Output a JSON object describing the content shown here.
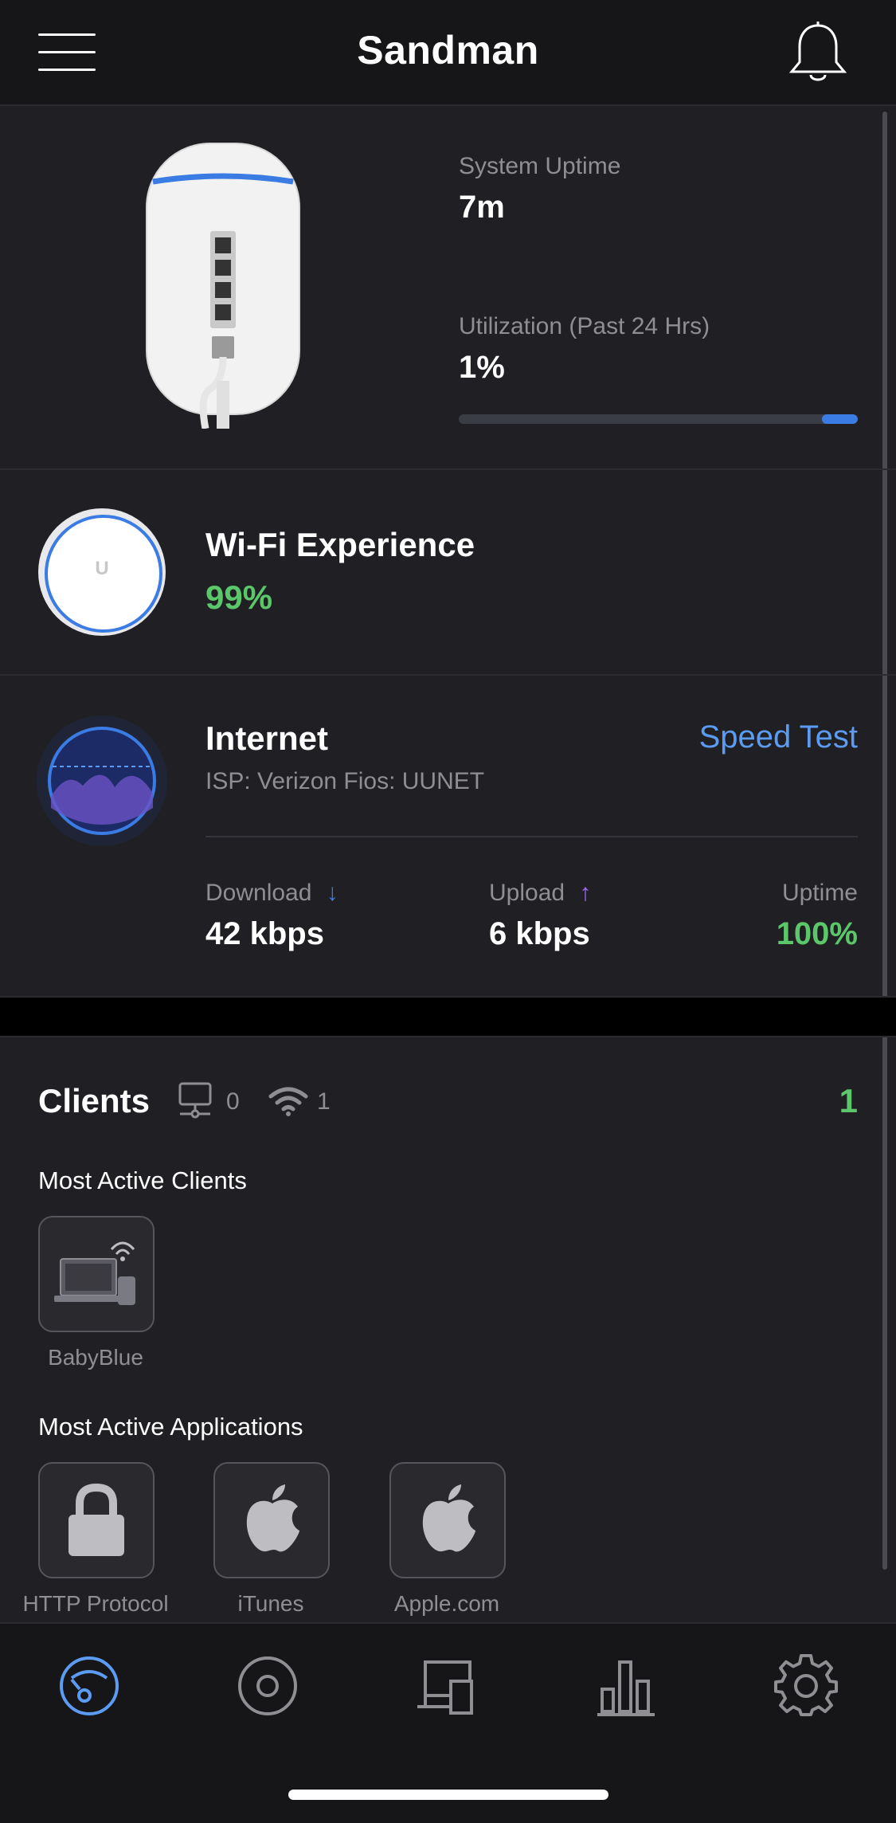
{
  "header": {
    "title": "Sandman",
    "menu_icon": "hamburger-menu-icon",
    "notifications_icon": "bell-icon"
  },
  "system": {
    "uptime_label": "System Uptime",
    "uptime_value": "7m",
    "utilization_label": "Utilization (Past 24 Hrs)",
    "utilization_value": "1%",
    "utilization_fraction": 0.09
  },
  "wifi": {
    "title": "Wi-Fi Experience",
    "value": "99%",
    "logo_letter": "U"
  },
  "internet": {
    "title": "Internet",
    "isp": "ISP: Verizon Fios: UUNET",
    "speed_test_label": "Speed Test",
    "download_label": "Download",
    "download_value": "42 kbps",
    "upload_label": "Upload",
    "upload_value": "6 kbps",
    "uptime_label": "Uptime",
    "uptime_value": "100%"
  },
  "clients": {
    "title": "Clients",
    "wired_count": "0",
    "wireless_count": "1",
    "total": "1",
    "most_active_clients_heading": "Most Active Clients",
    "most_active_clients": [
      {
        "name": "BabyBlue",
        "icon": "laptop-phone-wifi-icon"
      }
    ],
    "most_active_apps_heading": "Most Active Applications",
    "most_active_apps": [
      {
        "name": "HTTP Protocol",
        "icon": "lock-icon"
      },
      {
        "name": "iTunes",
        "icon": "apple-icon"
      },
      {
        "name": "Apple.com",
        "icon": "apple-icon"
      }
    ]
  },
  "tabs": [
    {
      "name": "dashboard",
      "icon": "dashboard-icon",
      "active": true
    },
    {
      "name": "devices",
      "icon": "circle-target-icon",
      "active": false
    },
    {
      "name": "clients",
      "icon": "client-devices-icon",
      "active": false
    },
    {
      "name": "statistics",
      "icon": "bar-chart-icon",
      "active": false
    },
    {
      "name": "settings",
      "icon": "gear-icon",
      "active": false
    }
  ],
  "colors": {
    "accent_blue": "#3a7be4",
    "link_blue": "#5b9cf2",
    "success_green": "#5cc76a",
    "upload_purple": "#9b6cf0"
  }
}
